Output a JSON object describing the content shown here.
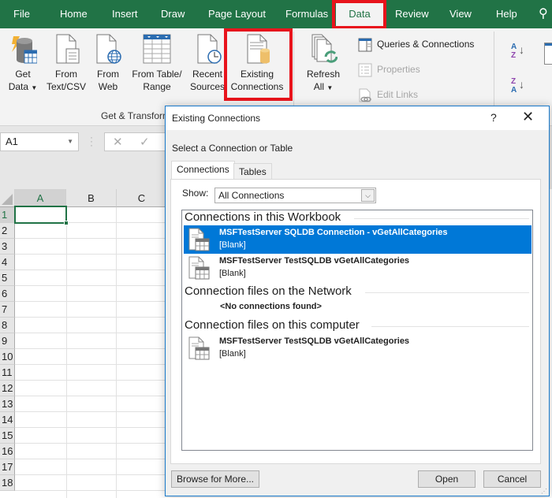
{
  "ribbon_tabs": [
    {
      "label": "File",
      "active": false
    },
    {
      "label": "Home",
      "active": false
    },
    {
      "label": "Insert",
      "active": false
    },
    {
      "label": "Draw",
      "active": false
    },
    {
      "label": "Page Layout",
      "active": false
    },
    {
      "label": "Formulas",
      "active": false
    },
    {
      "label": "Data",
      "active": true
    },
    {
      "label": "Review",
      "active": false
    },
    {
      "label": "View",
      "active": false
    },
    {
      "label": "Help",
      "active": false
    }
  ],
  "ribbon": {
    "get_data": {
      "line1": "Get",
      "line2": "Data"
    },
    "from_text_csv": {
      "line1": "From",
      "line2": "Text/CSV"
    },
    "from_web": {
      "line1": "From",
      "line2": "Web"
    },
    "from_table_range": {
      "line1": "From Table/",
      "line2": "Range"
    },
    "recent_sources": {
      "line1": "Recent",
      "line2": "Sources"
    },
    "existing_connections": {
      "line1": "Existing",
      "line2": "Connections"
    },
    "refresh_all": {
      "line1": "Refresh",
      "line2": "All"
    },
    "queries_connections": "Queries & Connections",
    "properties": "Properties",
    "edit_links": "Edit Links",
    "group_get_transform": "Get & Transform Data"
  },
  "formula_bar": {
    "name_box": "A1",
    "cancel_glyph": "✕",
    "enter_glyph": "✓"
  },
  "sheet": {
    "columns": [
      "A",
      "B",
      "C"
    ],
    "rows": [
      "1",
      "2",
      "3",
      "4",
      "5",
      "6",
      "7",
      "8",
      "9",
      "10",
      "11",
      "12",
      "13",
      "14",
      "15",
      "16",
      "17",
      "18"
    ],
    "selected_cell": "A1"
  },
  "dialog": {
    "title": "Existing Connections",
    "help_glyph": "?",
    "close_glyph": "✕",
    "subtitle": "Select a Connection or Table",
    "tabs": [
      {
        "label": "Connections",
        "active": true
      },
      {
        "label": "Tables",
        "active": false
      }
    ],
    "show_label": "Show:",
    "show_value": "All Connections",
    "sections": [
      {
        "header": "Connections in this Workbook",
        "items": [
          {
            "name": "MSFTestServer SQLDB Connection - vGetAllCategories",
            "description": "[Blank]",
            "selected": true
          },
          {
            "name": "MSFTestServer TestSQLDB vGetAllCategories",
            "description": "[Blank]",
            "selected": false
          }
        ]
      },
      {
        "header": "Connection files on the Network",
        "empty_text": "<No connections found>"
      },
      {
        "header": "Connection files on this computer",
        "items": [
          {
            "name": "MSFTestServer TestSQLDB vGetAllCategories",
            "description": "[Blank]",
            "selected": false
          }
        ]
      }
    ],
    "buttons": {
      "browse": "Browse for More...",
      "open": "Open",
      "cancel": "Cancel"
    }
  },
  "colors": {
    "excel_green": "#217346",
    "highlight_red": "#e8141c",
    "selection_blue": "#0078d7",
    "dialog_border": "#1979ca"
  }
}
